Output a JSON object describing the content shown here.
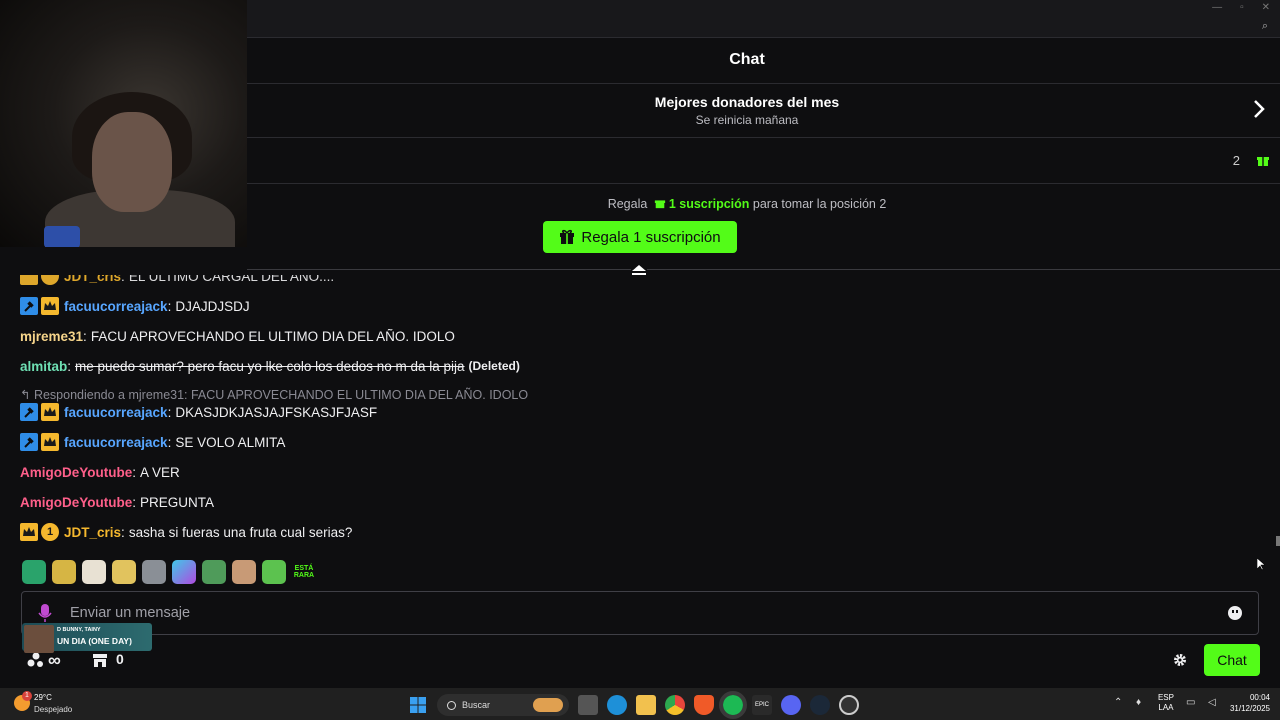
{
  "window": {
    "title": "Chat"
  },
  "donors": {
    "title": "Mejores donadores del mes",
    "subtitle": "Se reinicia mañana"
  },
  "rank": {
    "count": "2"
  },
  "gift_cta": {
    "prefix": "Regala",
    "highlight": "1 suscripción",
    "suffix": "para tomar la posición 2",
    "button_label": "Regala 1 suscripción"
  },
  "messages": [
    {
      "user": "JDT_cris",
      "text": "EL ULTIMO CARGAL DEL AÑO....",
      "color": "#f5b82e"
    },
    {
      "user": "facuucorreajack",
      "text": "DJAJDJSDJ",
      "color": "#58a6ff"
    },
    {
      "user": "mjreme31",
      "text": "FACU APROVECHANDO EL ULTIMO DIA DEL AÑO. IDOLO",
      "color": "#f5d48a"
    },
    {
      "user": "almitab",
      "text": "me puedo sumar? pero facu yo lke colo los dedos no m da la pija",
      "deleted_tag": "(Deleted)",
      "color": "#6fe0b4"
    },
    {
      "reply": "Respondiendo a mjreme31: FACU APROVECHANDO EL ULTIMO DIA DEL AÑO. IDOLO"
    },
    {
      "user": "facuucorreajack",
      "text": "DKASJDKJASJAJFSKASJFJASF",
      "color": "#58a6ff"
    },
    {
      "user": "facuucorreajack",
      "text": "SE VOLO ALMITA",
      "color": "#58a6ff"
    },
    {
      "user": "AmigoDeYoutube",
      "text": "A VER",
      "color": "#ff5f8a"
    },
    {
      "user": "AmigoDeYoutube",
      "text": "PREGUNTA",
      "color": "#ff5f8a"
    },
    {
      "user": "JDT_cris",
      "text": "sasha si fueras una fruta cual serias?",
      "badge_number": "1",
      "color": "#f5b82e"
    }
  ],
  "emotes": [
    "globe",
    "banana",
    "feet",
    "face",
    "bird",
    "tv",
    "croc",
    "horns",
    "frog",
    "ESTÁ RARA"
  ],
  "input": {
    "placeholder": "Enviar un mensaje"
  },
  "now_playing": {
    "artist": "D BUNNY, TAINY",
    "title": "UN DIA (ONE DAY)"
  },
  "toolbar": {
    "points": "∞",
    "store_count": "0",
    "send_label": "Chat"
  },
  "taskbar": {
    "temp": "29°C",
    "weather": "Despejado",
    "weather_badge": "1",
    "search": "Buscar",
    "lang1": "ESP",
    "lang2": "LAA",
    "time": "00:04",
    "date": "31/12/2025"
  },
  "colors": {
    "accent": "#53fc18",
    "background": "#0e0e10",
    "mod_badge": "#2f8de8",
    "crown_badge": "#f5b82e"
  }
}
